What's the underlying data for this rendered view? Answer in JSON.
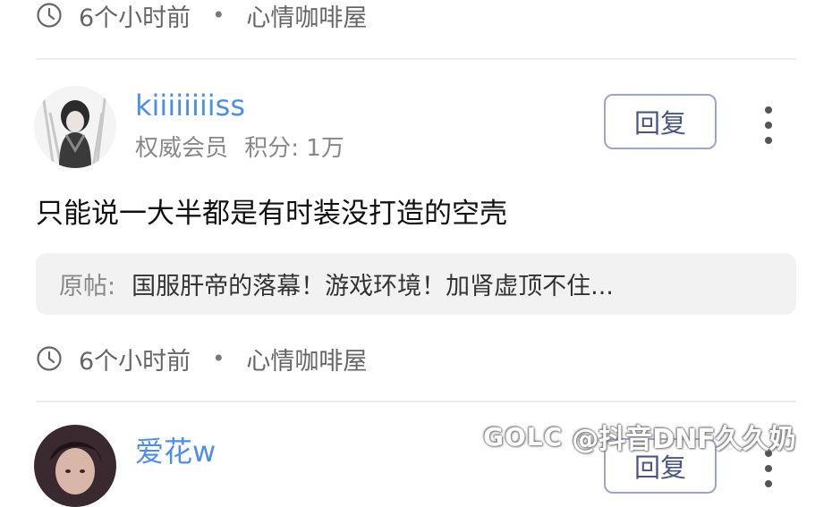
{
  "comments": [
    {
      "time": "6个小时前",
      "separator": "•",
      "topic": "心情咖啡屋"
    },
    {
      "username": "kiiiiiiiiss",
      "role": "权威会员",
      "points_label": "积分: 1万",
      "reply_label": "回复",
      "content": "只能说一大半都是有时装没打造的空壳",
      "quote_prefix": "原帖:",
      "quote_text": "国服肝帝的落幕！游戏环境！加肾虚顶不住...",
      "time": "6个小时前",
      "separator": "•",
      "topic": "心情咖啡屋"
    },
    {
      "username": "爱花w",
      "reply_label": "回复"
    }
  ],
  "watermark": {
    "logo": "GOLC",
    "text": "@抖音DNF久久奶"
  },
  "colors": {
    "username": "#4f8ee8",
    "reply_border": "#9aa6cc",
    "quote_bg": "#f2f2f2",
    "divider": "#ededed"
  }
}
